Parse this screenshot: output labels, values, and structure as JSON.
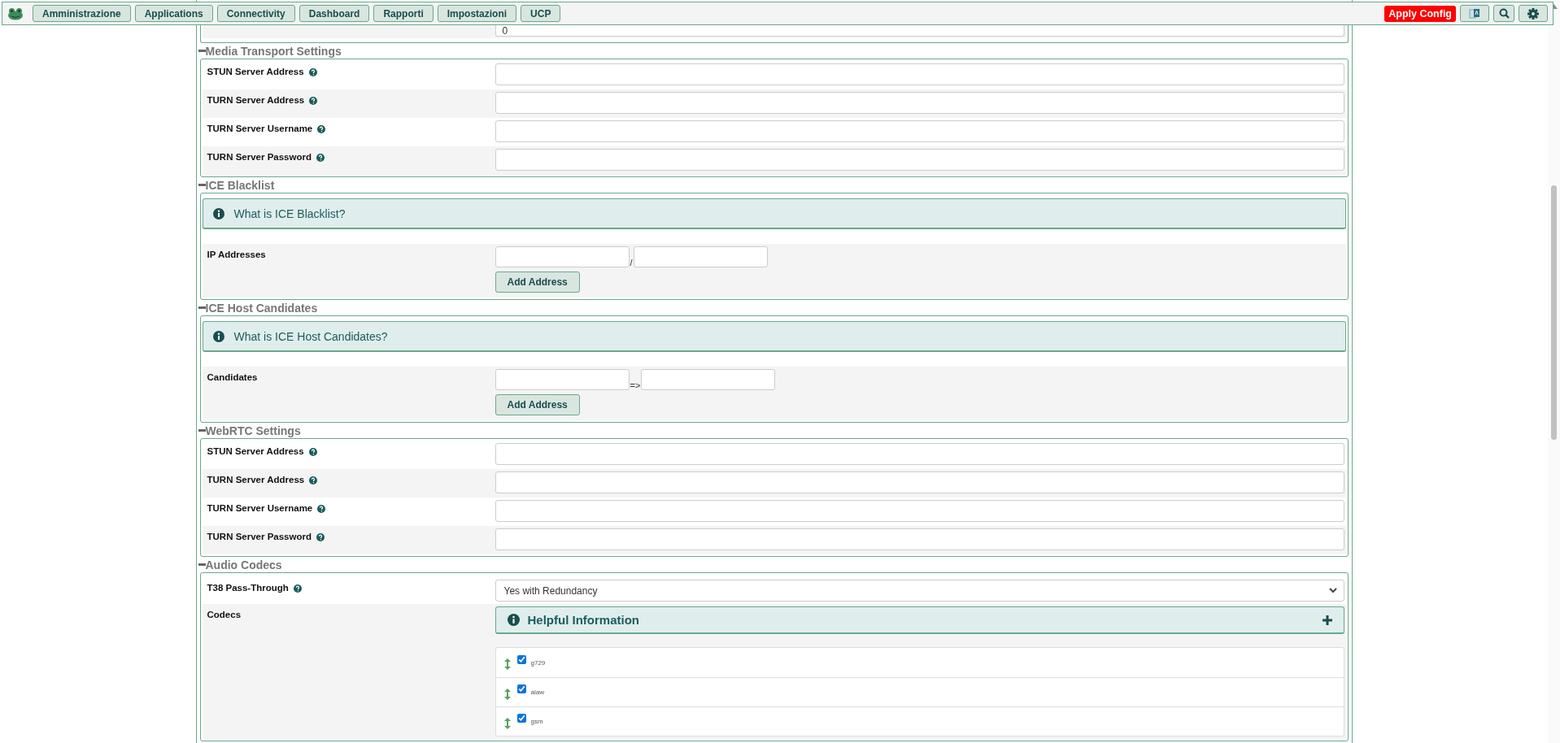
{
  "nav": {
    "items": [
      {
        "label": "Amministrazione"
      },
      {
        "label": "Applications"
      },
      {
        "label": "Connectivity"
      },
      {
        "label": "Dashboard"
      },
      {
        "label": "Rapporti"
      },
      {
        "label": "Impostazioni"
      },
      {
        "label": "UCP"
      }
    ],
    "apply_label": "Apply Config",
    "tools": [
      {
        "kind": "translate"
      },
      {
        "kind": "search"
      },
      {
        "kind": "settings"
      }
    ]
  },
  "sections": [
    {
      "rows": [
        {
          "kind": "text",
          "value": "0"
        }
      ]
    },
    {
      "title": "Media Transport Settings",
      "rows": [
        {
          "kind": "text",
          "label": "STUN Server Address",
          "help": true
        },
        {
          "kind": "text",
          "label": "TURN Server Address",
          "help": true
        },
        {
          "kind": "text",
          "label": "TURN Server Username",
          "help": true
        },
        {
          "kind": "text",
          "label": "TURN Server Password",
          "help": true
        }
      ]
    },
    {
      "title": "ICE Blacklist",
      "info": "What is ICE Blacklist?",
      "rows": [
        {
          "kind": "pair",
          "label": "IP Addresses",
          "help": false,
          "separator": "/",
          "button": "Add Address"
        }
      ]
    },
    {
      "title": "ICE Host Candidates",
      "info": "What is ICE Host Candidates?",
      "rows": [
        {
          "kind": "pair",
          "label": "Candidates",
          "help": false,
          "separator": "=>",
          "button": "Add Address"
        }
      ]
    },
    {
      "title": "WebRTC Settings",
      "rows": [
        {
          "kind": "text",
          "label": "STUN Server Address",
          "help": true
        },
        {
          "kind": "text",
          "label": "TURN Server Address",
          "help": true
        },
        {
          "kind": "text",
          "label": "TURN Server Username",
          "help": true
        },
        {
          "kind": "text",
          "label": "TURN Server Password",
          "help": true
        }
      ]
    },
    {
      "title": "Audio Codecs",
      "rows": [
        {
          "kind": "select",
          "label": "T38 Pass-Through",
          "help": true,
          "value": "Yes with Redundancy"
        },
        {
          "kind": "codecs",
          "label": "Codecs",
          "help": false,
          "info": "Helpful Information",
          "codecs": [
            {
              "name": "g729",
              "checked": true
            },
            {
              "name": "alaw",
              "checked": true
            },
            {
              "name": "gsm",
              "checked": true
            }
          ]
        }
      ]
    }
  ]
}
